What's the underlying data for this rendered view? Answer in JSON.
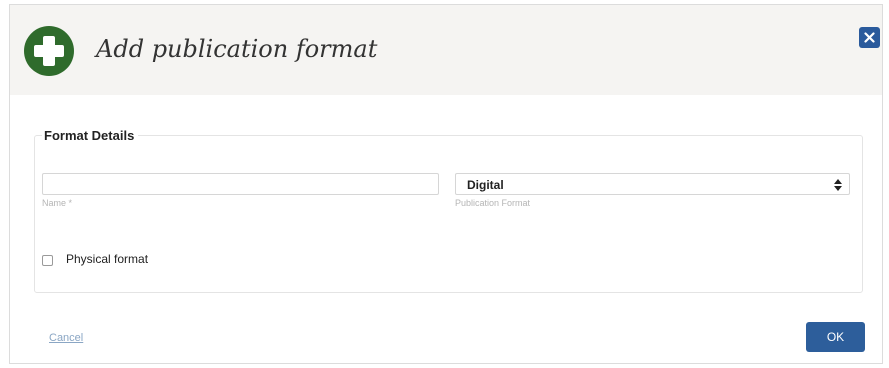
{
  "dialog": {
    "title": "Add publication format",
    "header_icon": "plus-circle-icon",
    "close_icon": "close-icon"
  },
  "form": {
    "legend": "Format Details",
    "name_field": {
      "value": "",
      "label": "Name *"
    },
    "format_select": {
      "selected": "Digital",
      "label": "Publication Format"
    },
    "physical_format": {
      "label": "Physical format",
      "checked": false
    }
  },
  "actions": {
    "cancel_label": "Cancel",
    "ok_label": "OK"
  },
  "colors": {
    "brand_green": "#2f6b2c",
    "primary_blue": "#2d5e9b",
    "link_blue": "#8aa6c4",
    "header_bg": "#f5f4f2"
  }
}
